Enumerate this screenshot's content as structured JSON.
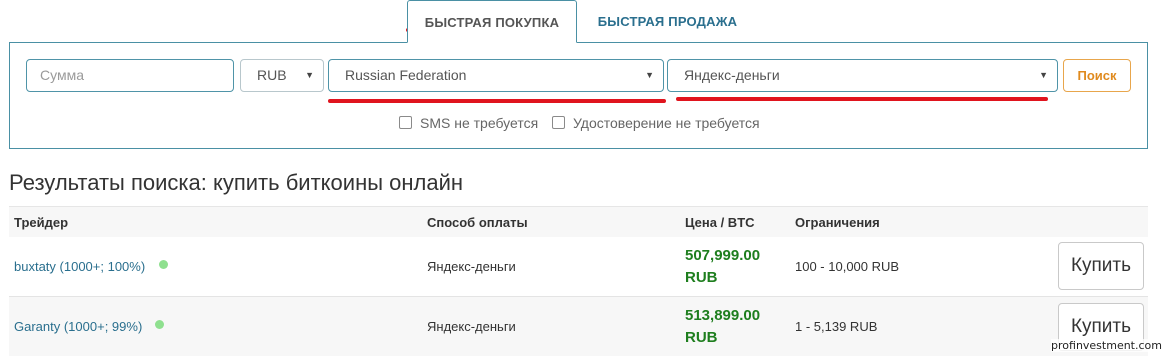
{
  "tabs": {
    "buy_label": "БЫСТРАЯ ПОКУПКА",
    "sell_label": "БЫСТРАЯ ПРОДАЖА"
  },
  "search": {
    "amount_placeholder": "Сумма",
    "currency_value": "RUB",
    "country_value": "Russian Federation",
    "method_value": "Яндекс-деньги",
    "search_label": "Поиск",
    "sms_label": "SMS не требуется",
    "id_label": "Удостоверение не требуется",
    "sms_checked": false,
    "id_checked": false
  },
  "results": {
    "title": "Результаты поиска: купить биткоины онлайн",
    "headers": {
      "trader": "Трейдер",
      "method": "Способ оплаты",
      "price": "Цена / BTC",
      "limits": "Ограничения"
    },
    "rows": [
      {
        "trader": "buxtaty (1000+; 100%)",
        "method": "Яндекс-деньги",
        "price_amount": "507,999.00",
        "price_currency": "RUB",
        "limits": "100 - 10,000 RUB",
        "buy_label": "Купить"
      },
      {
        "trader": "Garanty (1000+; 99%)",
        "method": "Яндекс-деньги",
        "price_amount": "513,899.00",
        "price_currency": "RUB",
        "limits": "1 - 5,139 RUB",
        "buy_label": "Купить"
      }
    ]
  },
  "watermark": "profinvestment.com",
  "colors": {
    "accent": "#4a90a4",
    "link": "#2a6f8e",
    "price": "#1e7e1e",
    "search_button": "#e08a1e",
    "highlight": "#e0141e",
    "online_dot": "#8fe08f"
  }
}
